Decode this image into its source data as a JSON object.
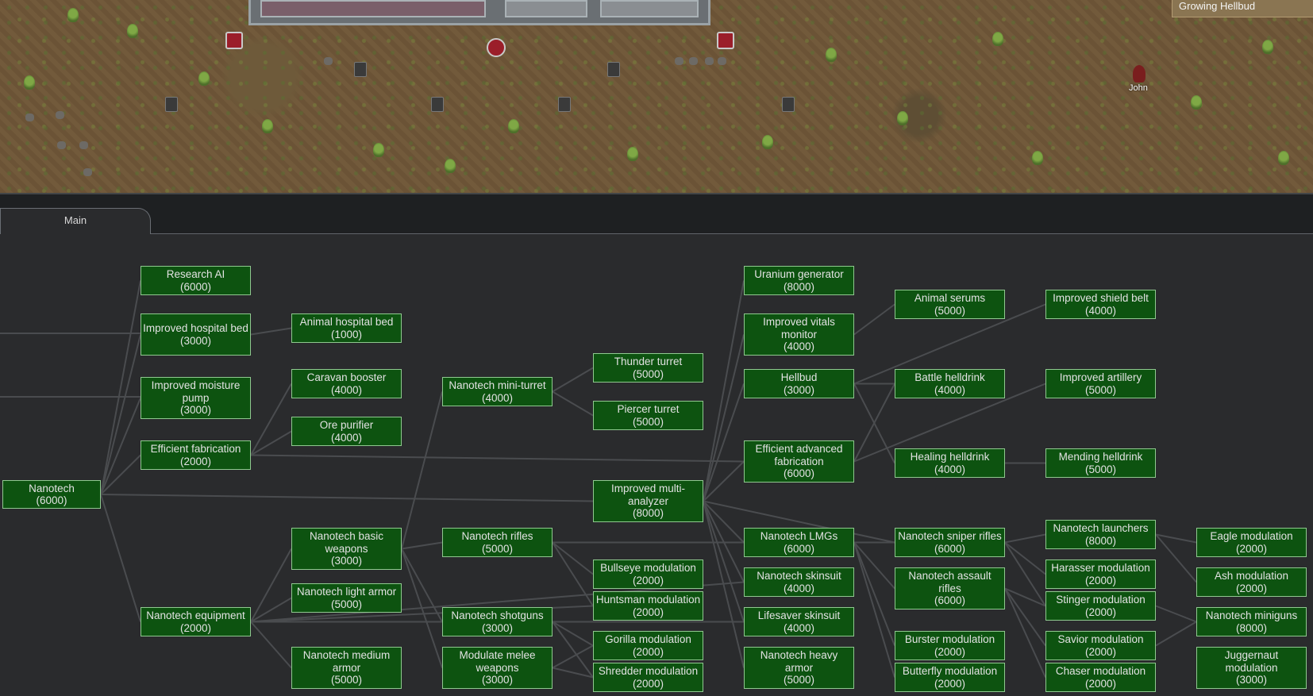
{
  "map": {
    "notice": "Growing Hellbud",
    "colonist_name": "John"
  },
  "tabs": [
    {
      "label": "Main"
    }
  ],
  "nodes": [
    {
      "id": "nanotech",
      "name": "Nanotech",
      "cost": "(6000)"
    },
    {
      "id": "research_ai",
      "name": "Research AI",
      "cost": "(6000)"
    },
    {
      "id": "improved_hospital_bed",
      "name": "Improved hospital bed",
      "cost": "(3000)"
    },
    {
      "id": "improved_moisture_pump",
      "name": "Improved moisture pump",
      "cost": "(3000)"
    },
    {
      "id": "efficient_fabrication",
      "name": "Efficient fabrication",
      "cost": "(2000)"
    },
    {
      "id": "nanotech_equipment",
      "name": "Nanotech equipment",
      "cost": "(2000)"
    },
    {
      "id": "animal_hospital_bed",
      "name": "Animal hospital bed",
      "cost": "(1000)"
    },
    {
      "id": "caravan_booster",
      "name": "Caravan booster",
      "cost": "(4000)"
    },
    {
      "id": "ore_purifier",
      "name": "Ore purifier",
      "cost": "(4000)"
    },
    {
      "id": "nanotech_basic_weapons",
      "name": "Nanotech basic weapons",
      "cost": "(3000)"
    },
    {
      "id": "nanotech_light_armor",
      "name": "Nanotech light armor",
      "cost": "(5000)"
    },
    {
      "id": "nanotech_medium_armor",
      "name": "Nanotech medium armor",
      "cost": "(5000)"
    },
    {
      "id": "nanotech_mini_turret",
      "name": "Nanotech mini-turret",
      "cost": "(4000)"
    },
    {
      "id": "nanotech_rifles",
      "name": "Nanotech rifles",
      "cost": "(5000)"
    },
    {
      "id": "nanotech_shotguns",
      "name": "Nanotech shotguns",
      "cost": "(3000)"
    },
    {
      "id": "modulate_melee_weapons",
      "name": "Modulate melee weapons",
      "cost": "(3000)"
    },
    {
      "id": "thunder_turret",
      "name": "Thunder turret",
      "cost": "(5000)"
    },
    {
      "id": "piercer_turret",
      "name": "Piercer turret",
      "cost": "(5000)"
    },
    {
      "id": "improved_multi_analyzer",
      "name": "Improved multi-analyzer",
      "cost": "(8000)"
    },
    {
      "id": "bullseye_modulation",
      "name": "Bullseye modulation",
      "cost": "(2000)"
    },
    {
      "id": "huntsman_modulation",
      "name": "Huntsman modulation",
      "cost": "(2000)"
    },
    {
      "id": "gorilla_modulation",
      "name": "Gorilla modulation",
      "cost": "(2000)"
    },
    {
      "id": "shredder_modulation",
      "name": "Shredder modulation",
      "cost": "(2000)"
    },
    {
      "id": "uranium_generator",
      "name": "Uranium generator",
      "cost": "(8000)"
    },
    {
      "id": "improved_vitals_monitor",
      "name": "Improved vitals monitor",
      "cost": "(4000)"
    },
    {
      "id": "hellbud",
      "name": "Hellbud",
      "cost": "(3000)"
    },
    {
      "id": "efficient_advanced_fabrication",
      "name": "Efficient advanced fabrication",
      "cost": "(6000)"
    },
    {
      "id": "nanotech_lmgs",
      "name": "Nanotech LMGs",
      "cost": "(6000)"
    },
    {
      "id": "nanotech_skinsuit",
      "name": "Nanotech skinsuit",
      "cost": "(4000)"
    },
    {
      "id": "lifesaver_skinsuit",
      "name": "Lifesaver skinsuit",
      "cost": "(4000)"
    },
    {
      "id": "nanotech_heavy_armor",
      "name": "Nanotech heavy armor",
      "cost": "(5000)"
    },
    {
      "id": "animal_serums",
      "name": "Animal serums",
      "cost": "(5000)"
    },
    {
      "id": "battle_helldrink",
      "name": "Battle helldrink",
      "cost": "(4000)"
    },
    {
      "id": "healing_helldrink",
      "name": "Healing helldrink",
      "cost": "(4000)"
    },
    {
      "id": "nanotech_sniper_rifles",
      "name": "Nanotech sniper rifles",
      "cost": "(6000)"
    },
    {
      "id": "nanotech_assault_rifles",
      "name": "Nanotech assault rifles",
      "cost": "(6000)"
    },
    {
      "id": "burster_modulation",
      "name": "Burster modulation",
      "cost": "(2000)"
    },
    {
      "id": "butterfly_modulation",
      "name": "Butterfly modulation",
      "cost": "(2000)"
    },
    {
      "id": "improved_shield_belt",
      "name": "Improved shield belt",
      "cost": "(4000)"
    },
    {
      "id": "improved_artillery",
      "name": "Improved artillery",
      "cost": "(5000)"
    },
    {
      "id": "mending_helldrink",
      "name": "Mending helldrink",
      "cost": "(5000)"
    },
    {
      "id": "nanotech_launchers",
      "name": "Nanotech launchers",
      "cost": "(8000)"
    },
    {
      "id": "harasser_modulation",
      "name": "Harasser modulation",
      "cost": "(2000)"
    },
    {
      "id": "stinger_modulation",
      "name": "Stinger modulation",
      "cost": "(2000)"
    },
    {
      "id": "savior_modulation",
      "name": "Savior modulation",
      "cost": "(2000)"
    },
    {
      "id": "chaser_modulation",
      "name": "Chaser modulation",
      "cost": "(2000)"
    },
    {
      "id": "eagle_modulation",
      "name": "Eagle modulation",
      "cost": "(2000)"
    },
    {
      "id": "ash_modulation",
      "name": "Ash modulation",
      "cost": "(2000)"
    },
    {
      "id": "nanotech_miniguns",
      "name": "Nanotech miniguns",
      "cost": "(8000)"
    },
    {
      "id": "juggernaut_modulation",
      "name": "Juggernaut modulation",
      "cost": "(3000)"
    }
  ],
  "links": [
    [
      "nanotech",
      "research_ai"
    ],
    [
      "nanotech",
      "improved_hospital_bed"
    ],
    [
      "nanotech",
      "improved_moisture_pump"
    ],
    [
      "nanotech",
      "efficient_fabrication"
    ],
    [
      "nanotech",
      "nanotech_equipment"
    ],
    [
      "nanotech",
      "improved_multi_analyzer"
    ],
    [
      "improved_hospital_bed",
      "animal_hospital_bed"
    ],
    [
      "efficient_fabrication",
      "caravan_booster"
    ],
    [
      "efficient_fabrication",
      "ore_purifier"
    ],
    [
      "efficient_fabrication",
      "efficient_advanced_fabrication"
    ],
    [
      "nanotech_equipment",
      "nanotech_basic_weapons"
    ],
    [
      "nanotech_equipment",
      "nanotech_light_armor"
    ],
    [
      "nanotech_equipment",
      "nanotech_medium_armor"
    ],
    [
      "nanotech_equipment",
      "nanotech_shotguns"
    ],
    [
      "nanotech_equipment",
      "huntsman_modulation"
    ],
    [
      "nanotech_equipment",
      "nanotech_skinsuit"
    ],
    [
      "nanotech_equipment",
      "lifesaver_skinsuit"
    ],
    [
      "nanotech_basic_weapons",
      "nanotech_mini_turret"
    ],
    [
      "nanotech_basic_weapons",
      "nanotech_rifles"
    ],
    [
      "nanotech_basic_weapons",
      "nanotech_shotguns"
    ],
    [
      "nanotech_basic_weapons",
      "modulate_melee_weapons"
    ],
    [
      "nanotech_mini_turret",
      "thunder_turret"
    ],
    [
      "nanotech_mini_turret",
      "piercer_turret"
    ],
    [
      "nanotech_rifles",
      "bullseye_modulation"
    ],
    [
      "nanotech_rifles",
      "huntsman_modulation"
    ],
    [
      "nanotech_rifles",
      "nanotech_lmgs"
    ],
    [
      "nanotech_shotguns",
      "gorilla_modulation"
    ],
    [
      "nanotech_shotguns",
      "shredder_modulation"
    ],
    [
      "modulate_melee_weapons",
      "gorilla_modulation"
    ],
    [
      "modulate_melee_weapons",
      "shredder_modulation"
    ],
    [
      "improved_multi_analyzer",
      "uranium_generator"
    ],
    [
      "improved_multi_analyzer",
      "improved_vitals_monitor"
    ],
    [
      "improved_multi_analyzer",
      "hellbud"
    ],
    [
      "improved_multi_analyzer",
      "efficient_advanced_fabrication"
    ],
    [
      "improved_multi_analyzer",
      "nanotech_lmgs"
    ],
    [
      "improved_multi_analyzer",
      "nanotech_skinsuit"
    ],
    [
      "improved_multi_analyzer",
      "lifesaver_skinsuit"
    ],
    [
      "improved_multi_analyzer",
      "nanotech_heavy_armor"
    ],
    [
      "improved_multi_analyzer",
      "nanotech_sniper_rifles"
    ],
    [
      "improved_vitals_monitor",
      "animal_serums"
    ],
    [
      "hellbud",
      "battle_helldrink"
    ],
    [
      "hellbud",
      "healing_helldrink"
    ],
    [
      "hellbud",
      "improved_shield_belt"
    ],
    [
      "efficient_advanced_fabrication",
      "battle_helldrink"
    ],
    [
      "efficient_advanced_fabrication",
      "improved_artillery"
    ],
    [
      "healing_helldrink",
      "mending_helldrink"
    ],
    [
      "nanotech_lmgs",
      "nanotech_sniper_rifles"
    ],
    [
      "nanotech_lmgs",
      "nanotech_assault_rifles"
    ],
    [
      "nanotech_lmgs",
      "burster_modulation"
    ],
    [
      "nanotech_lmgs",
      "butterfly_modulation"
    ],
    [
      "nanotech_sniper_rifles",
      "nanotech_launchers"
    ],
    [
      "nanotech_sniper_rifles",
      "harasser_modulation"
    ],
    [
      "nanotech_sniper_rifles",
      "stinger_modulation"
    ],
    [
      "nanotech_assault_rifles",
      "savior_modulation"
    ],
    [
      "nanotech_assault_rifles",
      "chaser_modulation"
    ],
    [
      "nanotech_assault_rifles",
      "stinger_modulation"
    ],
    [
      "nanotech_launchers",
      "eagle_modulation"
    ],
    [
      "nanotech_launchers",
      "ash_modulation"
    ],
    [
      "stinger_modulation",
      "nanotech_miniguns"
    ],
    [
      "savior_modulation",
      "nanotech_miniguns"
    ]
  ]
}
